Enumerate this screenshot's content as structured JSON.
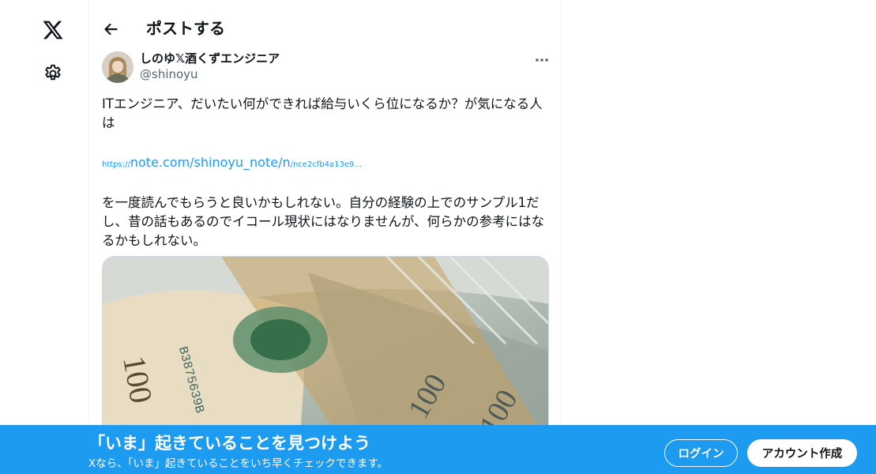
{
  "nav": {
    "logo_icon": "x-logo-icon",
    "settings_icon": "gear-icon"
  },
  "header": {
    "back_icon": "arrow-left-icon",
    "title": "ポストする"
  },
  "post": {
    "author_name": "しのゆ𝕏酒くずエンジニア",
    "author_handle": "@shinoyu",
    "more_icon": "ellipsis-icon",
    "text_line1": "ITエンジニア、だいたい何ができれば給与いくら位になるか？が気になる人は",
    "link_prefix": "https://",
    "link_main": "note.com/shinoyu_note/n",
    "link_suffix": "/nce2cfb4a13e9...",
    "text_line2": "を一度読んでもらうと良いかもしれない。自分の経験の上でのサンプル1だし、昔の話もあるのでイコール現状にはなりませんが、何らかの参考にはなるかもしれない。"
  },
  "banner": {
    "title": "「いま」起きていることを見つけよう",
    "subtitle": "Xなら、「いま」起きていることをいち早くチェックできます。",
    "login_label": "ログイン",
    "signup_label": "アカウント作成"
  },
  "colors": {
    "accent": "#1d9bf0",
    "text": "#0f1419",
    "secondary": "#536471"
  }
}
